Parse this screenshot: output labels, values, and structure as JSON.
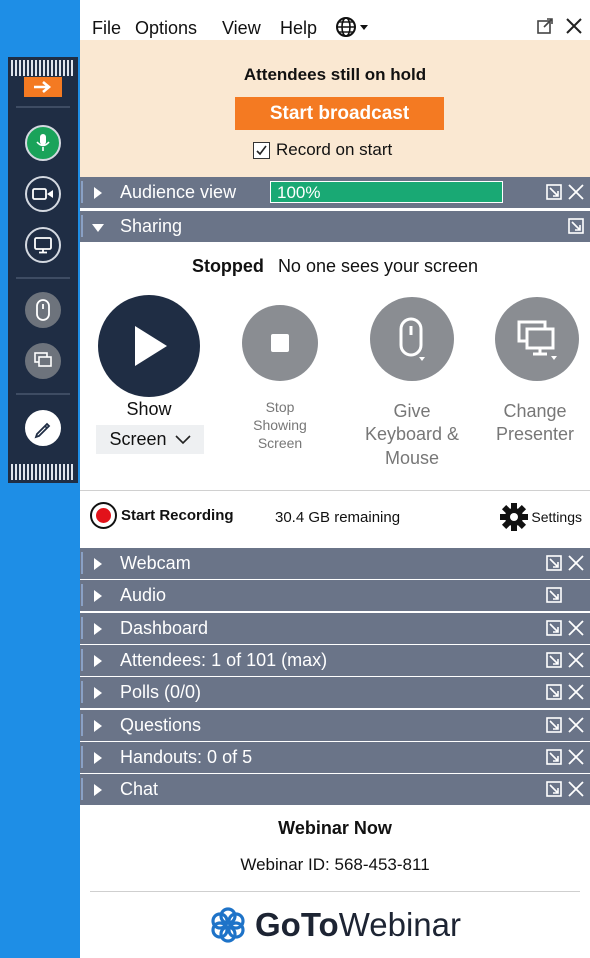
{
  "menu": {
    "items": [
      "File",
      "Options",
      "View",
      "Help"
    ],
    "globe_icon": "globe-icon"
  },
  "hold": {
    "title": "Attendees still on hold",
    "broadcast_label": "Start broadcast",
    "record_label": "Record on start",
    "record_checked": true
  },
  "audience": {
    "label": "Audience view",
    "percent": "100%",
    "level": 1.0
  },
  "sharing": {
    "label": "Sharing",
    "status_bold": "Stopped",
    "status_text": "No one sees your screen",
    "show": {
      "line1": "Show",
      "select": "Screen"
    },
    "stop": {
      "line1": "Stop",
      "line2": "Showing",
      "line3": "Screen"
    },
    "give": {
      "line1": "Give",
      "line2": "Keyboard &",
      "line3": "Mouse"
    },
    "change": {
      "line1": "Change",
      "line2": "Presenter"
    }
  },
  "recording": {
    "label": "Start Recording",
    "remaining": "30.4 GB remaining",
    "settings": "Settings"
  },
  "sections": [
    {
      "label": "Webcam",
      "close": true
    },
    {
      "label": "Audio",
      "close": false
    },
    {
      "label": "Dashboard",
      "close": true
    },
    {
      "label": "Attendees:  1 of 101 (max)",
      "close": true
    },
    {
      "label": "Polls (0/0)",
      "close": true
    },
    {
      "label": "Questions",
      "close": true
    },
    {
      "label": "Handouts: 0 of 5",
      "close": true
    },
    {
      "label": "Chat",
      "close": true
    }
  ],
  "footer": {
    "title": "Webinar Now",
    "webinar_id": "Webinar ID: 568-453-811",
    "brand_bold": "GoTo",
    "brand_rest": "Webinar"
  },
  "colors": {
    "accent": "#f47a22",
    "bar": "#6a7488",
    "meter": "#19a974",
    "hold_bg": "#fae8d2",
    "control_bg": "#1f2d44",
    "desktop": "#1e8ee6"
  }
}
